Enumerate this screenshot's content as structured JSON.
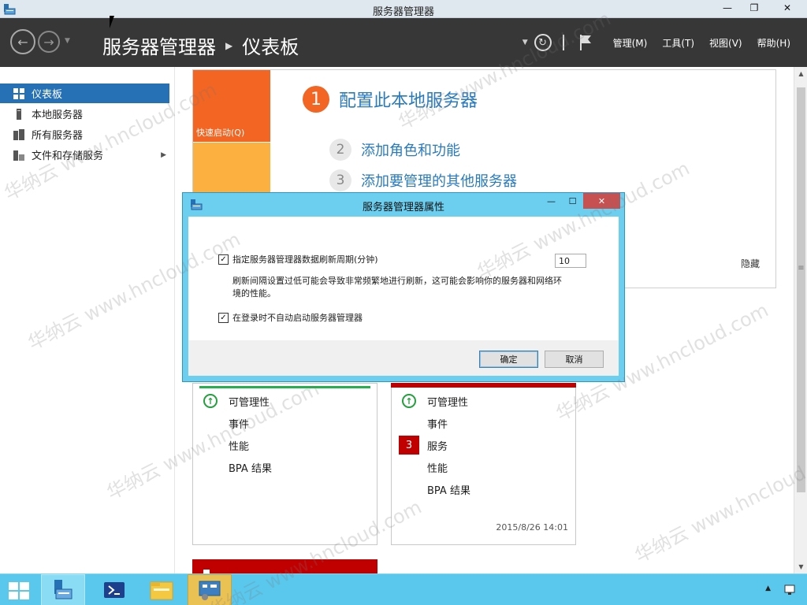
{
  "window": {
    "title": "服务器管理器"
  },
  "header": {
    "breadcrumb_root": "服务器管理器",
    "breadcrumb_page": "仪表板",
    "menus": [
      "管理(M)",
      "工具(T)",
      "视图(V)",
      "帮助(H)"
    ]
  },
  "sidebar": {
    "items": [
      {
        "label": "仪表板",
        "icon": "dashboard-icon",
        "active": true
      },
      {
        "label": "本地服务器",
        "icon": "server-icon"
      },
      {
        "label": "所有服务器",
        "icon": "servers-icon"
      },
      {
        "label": "文件和存储服务",
        "icon": "storage-icon"
      }
    ]
  },
  "welcome": {
    "quick_start": "快速启动(Q)",
    "step1_num": "1",
    "step1": "配置此本地服务器",
    "step2_num": "2",
    "step2": "添加角色和功能",
    "step3_num": "3",
    "step3": "添加要管理的其他服务器",
    "hide": "隐藏"
  },
  "cards": [
    {
      "rows": [
        "可管理性",
        "事件",
        "性能",
        "BPA 结果"
      ],
      "status": "ok"
    },
    {
      "rows": [
        "可管理性",
        "事件",
        "服务",
        "性能",
        "BPA 结果"
      ],
      "badge": "3",
      "timestamp": "2015/8/26 14:01"
    }
  ],
  "dialog": {
    "title": "服务器管理器属性",
    "refresh_label": "指定服务器管理器数据刷新周期(分钟)",
    "refresh_value": "10",
    "refresh_checked": true,
    "description": "刷新间隔设置过低可能会导致非常频繁地进行刷新，这可能会影响你的服务器和网络环境的性能。",
    "autostart_label": "在登录时不自动启动服务器管理器",
    "autostart_checked": true,
    "ok": "确定",
    "cancel": "取消"
  },
  "watermark": "华纳云 www.hncloud.com",
  "colors": {
    "accent": "#2670b5",
    "orange": "#f26522",
    "dialog_frame": "#6ccff0",
    "taskbar": "#5ac8ed",
    "alert": "#c00000",
    "ok": "#22b14c"
  }
}
